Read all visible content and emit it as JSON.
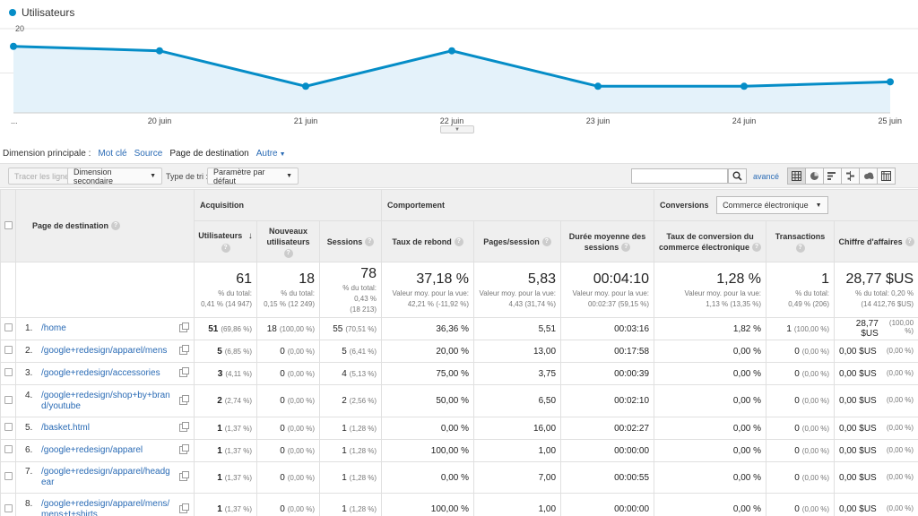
{
  "chart_data": {
    "type": "area",
    "series": [
      {
        "name": "Utilisateurs",
        "values": [
          15,
          14,
          6,
          14,
          6,
          6,
          7
        ]
      }
    ],
    "x": [
      "",
      "20 juin",
      "21 juin",
      "22 juin",
      "23 juin",
      "24 juin",
      "25 juin"
    ],
    "x_first_label": "...",
    "ylim": [
      0,
      20
    ],
    "y_ticks": [
      "20",
      "10"
    ],
    "grid": true,
    "color": "#058dc7",
    "fill": "#e4f2fa"
  },
  "dimension": {
    "label": "Dimension principale :",
    "options": [
      "Mot clé",
      "Source",
      "Page de destination",
      "Autre"
    ],
    "active_index": 2
  },
  "toolbar": {
    "plot_rows": "Tracer les lignes",
    "secondary_dimension": "Dimension secondaire",
    "sort_type_label": "Type de tri :",
    "sort_type_value": "Paramètre par défaut",
    "search_value": "",
    "advanced": "avancé"
  },
  "table": {
    "dimension_header": "Page de destination",
    "groups": {
      "acquisition": "Acquisition",
      "behavior": "Comportement",
      "conversions": "Conversions",
      "conversions_select": "Commerce électronique"
    },
    "columns": [
      "Utilisateurs",
      "Nouveaux utilisateurs",
      "Sessions",
      "Taux de rebond",
      "Pages/session",
      "Durée moyenne des sessions",
      "Taux de conversion du commerce électronique",
      "Transactions",
      "Chiffre d'affaires"
    ],
    "totals": [
      {
        "value": "61",
        "sub1": "% du total:",
        "sub2": "0,41 % (14 947)"
      },
      {
        "value": "18",
        "sub1": "% du total:",
        "sub2": "0,15 % (12 249)"
      },
      {
        "value": "78",
        "sub1": "% du total:",
        "sub2": "0,43 %",
        "sub3": "(18 213)"
      },
      {
        "value": "37,18 %",
        "sub1": "Valeur moy. pour la vue:",
        "sub2": "42,21 % (-11,92 %)"
      },
      {
        "value": "5,83",
        "sub1": "Valeur moy. pour la vue:",
        "sub2": "4,43 (31,74 %)"
      },
      {
        "value": "00:04:10",
        "sub1": "Valeur moy. pour la vue:",
        "sub2": "00:02:37 (59,15 %)"
      },
      {
        "value": "1,28 %",
        "sub1": "Valeur moy. pour la vue:",
        "sub2": "1,13 % (13,35 %)"
      },
      {
        "value": "1",
        "sub1": "% du total:",
        "sub2": "0,49 % (206)"
      },
      {
        "value": "28,77 $US",
        "sub1": "% du total: 0,20 %",
        "sub2": "(14 412,76 $US)"
      }
    ],
    "rows": [
      {
        "num": "1.",
        "page": "/home",
        "users": "51",
        "users_pct": "(69,86 %)",
        "new": "18",
        "new_pct": "(100,00 %)",
        "sessions": "55",
        "sessions_pct": "(70,51 %)",
        "bounce": "36,36 %",
        "pps": "5,51",
        "dur": "00:03:16",
        "conv": "1,82 %",
        "trans": "1",
        "trans_pct": "(100,00 %)",
        "rev": "28,77 $US",
        "rev_pct": "(100,00 %)"
      },
      {
        "num": "2.",
        "page": "/google+redesign/apparel/mens",
        "users": "5",
        "users_pct": "(6,85 %)",
        "new": "0",
        "new_pct": "(0,00 %)",
        "sessions": "5",
        "sessions_pct": "(6,41 %)",
        "bounce": "20,00 %",
        "pps": "13,00",
        "dur": "00:17:58",
        "conv": "0,00 %",
        "trans": "0",
        "trans_pct": "(0,00 %)",
        "rev": "0,00 $US",
        "rev_pct": "(0,00 %)"
      },
      {
        "num": "3.",
        "page": "/google+redesign/accessories",
        "users": "3",
        "users_pct": "(4,11 %)",
        "new": "0",
        "new_pct": "(0,00 %)",
        "sessions": "4",
        "sessions_pct": "(5,13 %)",
        "bounce": "75,00 %",
        "pps": "3,75",
        "dur": "00:00:39",
        "conv": "0,00 %",
        "trans": "0",
        "trans_pct": "(0,00 %)",
        "rev": "0,00 $US",
        "rev_pct": "(0,00 %)"
      },
      {
        "num": "4.",
        "page": "/google+redesign/shop+by+brand/youtube",
        "users": "2",
        "users_pct": "(2,74 %)",
        "new": "0",
        "new_pct": "(0,00 %)",
        "sessions": "2",
        "sessions_pct": "(2,56 %)",
        "bounce": "50,00 %",
        "pps": "6,50",
        "dur": "00:02:10",
        "conv": "0,00 %",
        "trans": "0",
        "trans_pct": "(0,00 %)",
        "rev": "0,00 $US",
        "rev_pct": "(0,00 %)"
      },
      {
        "num": "5.",
        "page": "/basket.html",
        "users": "1",
        "users_pct": "(1,37 %)",
        "new": "0",
        "new_pct": "(0,00 %)",
        "sessions": "1",
        "sessions_pct": "(1,28 %)",
        "bounce": "0,00 %",
        "pps": "16,00",
        "dur": "00:02:27",
        "conv": "0,00 %",
        "trans": "0",
        "trans_pct": "(0,00 %)",
        "rev": "0,00 $US",
        "rev_pct": "(0,00 %)"
      },
      {
        "num": "6.",
        "page": "/google+redesign/apparel",
        "users": "1",
        "users_pct": "(1,37 %)",
        "new": "0",
        "new_pct": "(0,00 %)",
        "sessions": "1",
        "sessions_pct": "(1,28 %)",
        "bounce": "100,00 %",
        "pps": "1,00",
        "dur": "00:00:00",
        "conv": "0,00 %",
        "trans": "0",
        "trans_pct": "(0,00 %)",
        "rev": "0,00 $US",
        "rev_pct": "(0,00 %)"
      },
      {
        "num": "7.",
        "page": "/google+redesign/apparel/headgear",
        "users": "1",
        "users_pct": "(1,37 %)",
        "new": "0",
        "new_pct": "(0,00 %)",
        "sessions": "1",
        "sessions_pct": "(1,28 %)",
        "bounce": "0,00 %",
        "pps": "7,00",
        "dur": "00:00:55",
        "conv": "0,00 %",
        "trans": "0",
        "trans_pct": "(0,00 %)",
        "rev": "0,00 $US",
        "rev_pct": "(0,00 %)"
      },
      {
        "num": "8.",
        "page": "/google+redesign/apparel/mens/mens+t+shirts",
        "users": "1",
        "users_pct": "(1,37 %)",
        "new": "0",
        "new_pct": "(0,00 %)",
        "sessions": "1",
        "sessions_pct": "(1,28 %)",
        "bounce": "100,00 %",
        "pps": "1,00",
        "dur": "00:00:00",
        "conv": "0,00 %",
        "trans": "0",
        "trans_pct": "(0,00 %)",
        "rev": "0,00 $US",
        "rev_pct": "(0,00 %)"
      }
    ]
  }
}
